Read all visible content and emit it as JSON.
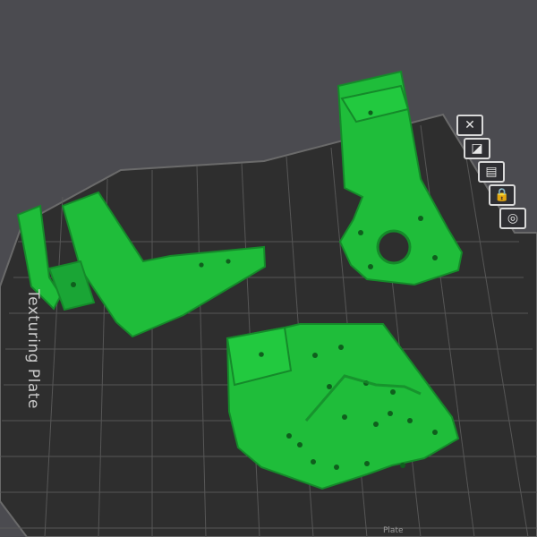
{
  "viewport": {
    "plate_label": "Texturing Plate",
    "footer_text": "Plate"
  },
  "colors": {
    "background": "#4b4b50",
    "plate": "#2e2e2e",
    "grid": "#5b5b5b",
    "model": "#1fbd3a",
    "model_shade": "#158a2a"
  },
  "toolbar": {
    "buttons": [
      {
        "icon": "close-icon",
        "glyph": "✕"
      },
      {
        "icon": "view-icon",
        "glyph": "◪"
      },
      {
        "icon": "layout-icon",
        "glyph": "▤"
      },
      {
        "icon": "lock-icon",
        "glyph": "🔒"
      },
      {
        "icon": "settings-icon",
        "glyph": "◎"
      }
    ]
  }
}
